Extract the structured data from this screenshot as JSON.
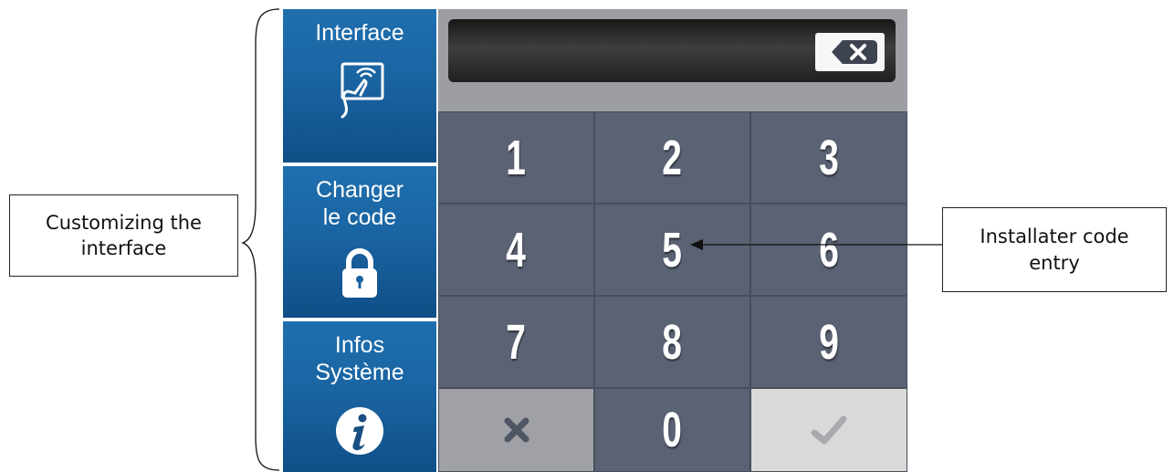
{
  "annotations": {
    "left_callout": "Customizing the\ninterface",
    "right_callout": "Installater code\nentry"
  },
  "sidebar": {
    "items": [
      {
        "label": "Interface",
        "icon": "touch-hand-icon"
      },
      {
        "label": "Changer\nle code",
        "icon": "padlock-icon"
      },
      {
        "label": "Infos\nSystème",
        "icon": "info-icon"
      }
    ]
  },
  "keypad": {
    "display_value": "",
    "backspace_icon": "backspace-icon",
    "keys": [
      "1",
      "2",
      "3",
      "4",
      "5",
      "6",
      "7",
      "8",
      "9",
      "",
      "0",
      ""
    ],
    "cancel_icon": "cross-icon",
    "confirm_icon": "checkmark-icon"
  },
  "colors": {
    "sidebar_blue": "#1a64a2",
    "key_gray": "#5a6273",
    "panel_gray": "#9c9ea3",
    "cancel_gray": "#9fa1a6",
    "confirm_light": "#d9d9d9"
  }
}
